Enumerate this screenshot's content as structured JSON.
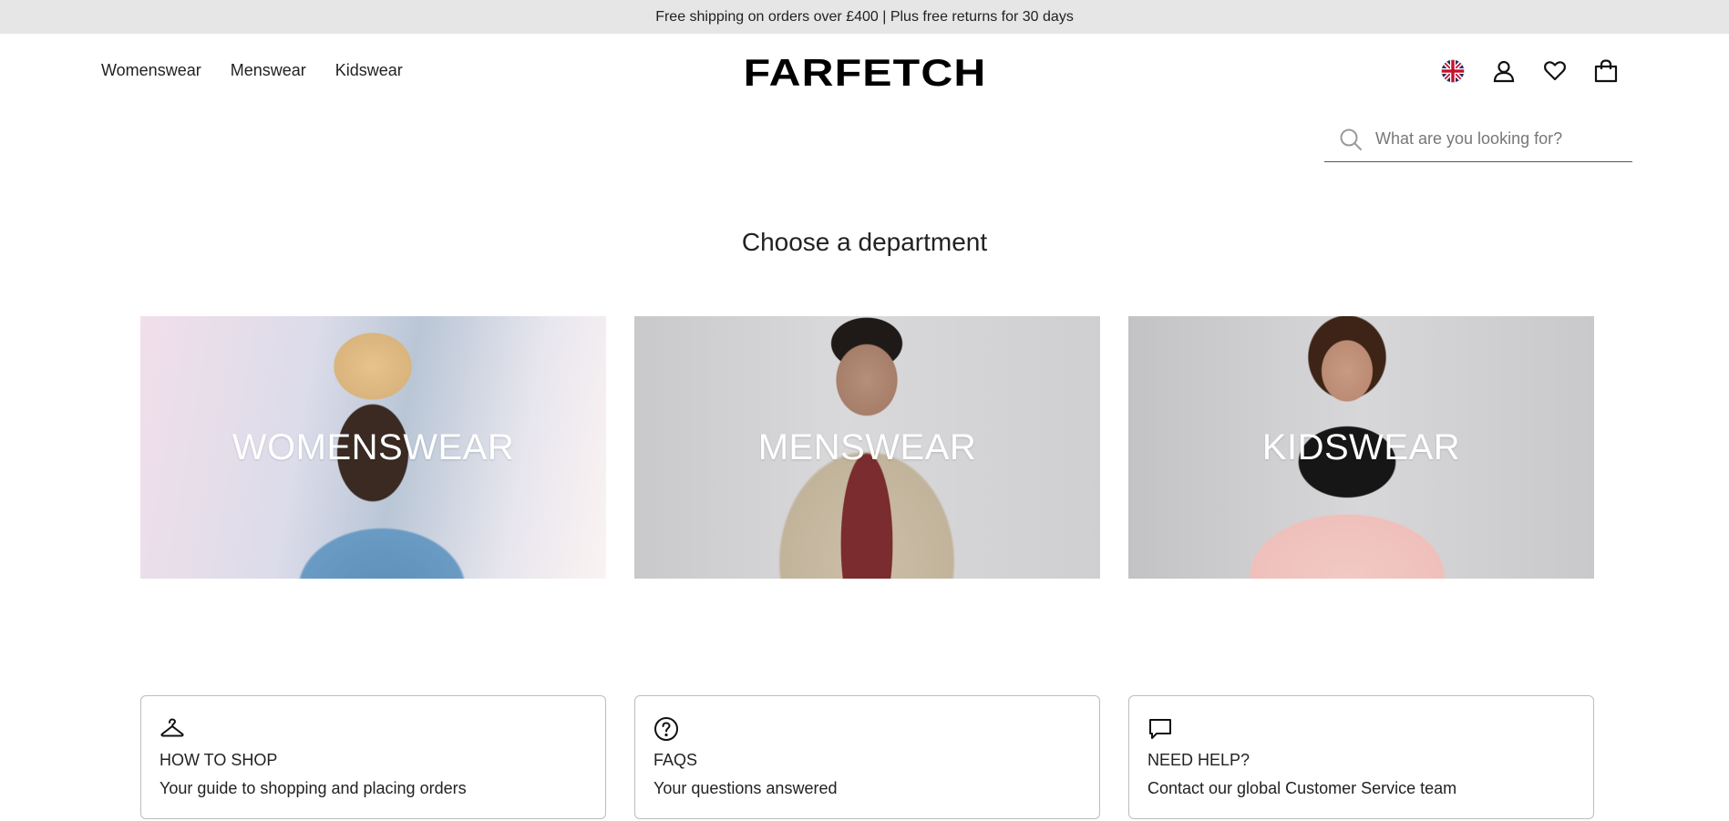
{
  "promo": {
    "text": "Free shipping on orders over £400 | Plus free returns for 30 days"
  },
  "header": {
    "nav": [
      {
        "label": "Womenswear"
      },
      {
        "label": "Menswear"
      },
      {
        "label": "Kidswear"
      }
    ],
    "logo": "FARFETCH",
    "icons": [
      "uk-flag-icon",
      "account-icon",
      "wishlist-heart-icon",
      "shopping-bag-icon"
    ]
  },
  "search": {
    "placeholder": "What are you looking for?",
    "value": ""
  },
  "main": {
    "title": "Choose a department",
    "departments": [
      {
        "label": "WOMENSWEAR"
      },
      {
        "label": "MENSWEAR"
      },
      {
        "label": "KIDSWEAR"
      }
    ]
  },
  "help": [
    {
      "icon": "hanger-icon",
      "title": "HOW TO SHOP",
      "description": "Your guide to shopping and placing orders"
    },
    {
      "icon": "question-circle-icon",
      "title": "FAQS",
      "description": "Your questions answered"
    },
    {
      "icon": "chat-bubble-icon",
      "title": "NEED HELP?",
      "description": "Contact our global Customer Service team"
    }
  ],
  "colors": {
    "promo_bg": "#e6e6e6",
    "text": "#222222",
    "flag_blue": "#1f2f6b",
    "flag_red": "#c8102e"
  }
}
